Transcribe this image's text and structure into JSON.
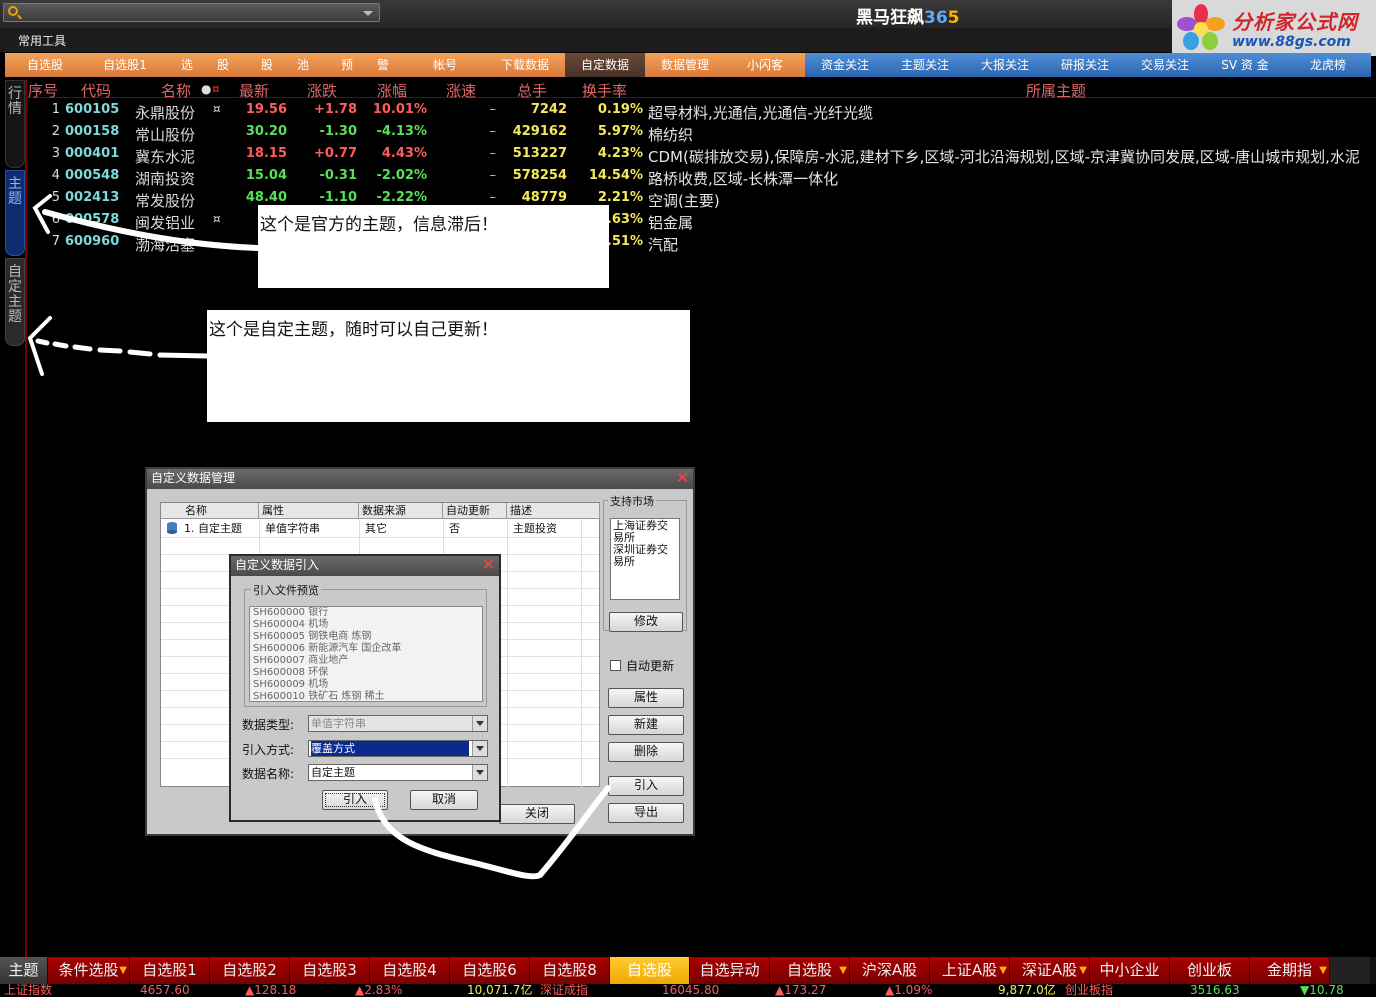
{
  "app": {
    "title_main": "黑马狂飙",
    "title_num_a": "36",
    "title_num_b": "5",
    "search_placeholder": ""
  },
  "logo": {
    "name": "分析家公式网",
    "url": "www.88gs.com"
  },
  "menu": {
    "label": "常用工具"
  },
  "top_tabs": [
    {
      "label": "自选股",
      "style": "orange"
    },
    {
      "label": "自选股1",
      "style": "orange"
    },
    {
      "label": "选　　股",
      "style": "orange"
    },
    {
      "label": "股　　池",
      "style": "orange"
    },
    {
      "label": "预　　警",
      "style": "orange"
    },
    {
      "label": "帐号",
      "style": "orange"
    },
    {
      "label": "下载数据",
      "style": "orange"
    },
    {
      "label": "自定数据",
      "style": "orange-active"
    },
    {
      "label": "数据管理",
      "style": "orange"
    },
    {
      "label": "小闪客",
      "style": "orange"
    },
    {
      "label": "资金关注",
      "style": "blue"
    },
    {
      "label": "主题关注",
      "style": "blue"
    },
    {
      "label": "大报关注",
      "style": "blue"
    },
    {
      "label": "研报关注",
      "style": "blue"
    },
    {
      "label": "交易关注",
      "style": "blue"
    },
    {
      "label": "SV 资 金",
      "style": "blue"
    },
    {
      "label": "龙虎榜",
      "style": "blue"
    }
  ],
  "side_tabs": {
    "quotes": "行情",
    "theme": "主题",
    "custom_theme": "自定主题"
  },
  "table": {
    "headers": {
      "seq": "序号",
      "code": "代码",
      "name": "名称",
      "mark": "●",
      "flag": "¤",
      "price": "最新",
      "chg": "涨跌",
      "pct": "涨幅",
      "speed": "涨速",
      "volume": "总手",
      "turnover": "换手率",
      "theme": "所属主题"
    },
    "rows": [
      {
        "seq": "1",
        "code": "600105",
        "name": "永鼎股份",
        "mark": "¤",
        "price": "19.56",
        "chg": "+1.78",
        "pct": "10.01%",
        "speed": "–",
        "volume": "7242",
        "turnover": "0.19%",
        "theme": "超导材料,光通信,光通信-光纤光缆",
        "dir": "up"
      },
      {
        "seq": "2",
        "code": "000158",
        "name": "常山股份",
        "mark": "",
        "price": "30.20",
        "chg": "-1.30",
        "pct": "-4.13%",
        "speed": "–",
        "volume": "429162",
        "turnover": "5.97%",
        "theme": "棉纺织",
        "dir": "down"
      },
      {
        "seq": "3",
        "code": "000401",
        "name": "冀东水泥",
        "mark": "",
        "price": "18.15",
        "chg": "+0.77",
        "pct": "4.43%",
        "speed": "–",
        "volume": "513227",
        "turnover": "4.23%",
        "theme": "CDM(碳排放交易),保障房-水泥,建材下乡,区域-河北沿海规划,区域-京津冀协同发展,区域-唐山城市规划,水泥",
        "dir": "up"
      },
      {
        "seq": "4",
        "code": "000548",
        "name": "湖南投资",
        "mark": "",
        "price": "15.04",
        "chg": "-0.31",
        "pct": "-2.02%",
        "speed": "–",
        "volume": "578254",
        "turnover": "14.54%",
        "theme": "路桥收费,区域-长株潭一体化",
        "dir": "down"
      },
      {
        "seq": "5",
        "code": "002413",
        "name": "常发股份",
        "mark": "",
        "price": "48.40",
        "chg": "-1.10",
        "pct": "-2.22%",
        "speed": "–",
        "volume": "48779",
        "turnover": "2.21%",
        "theme": "空调(主要)",
        "dir": "down"
      },
      {
        "seq": "6",
        "code": "000578",
        "name": "闽发铝业",
        "mark": "¤",
        "price": "4",
        "chg": "",
        "pct": "",
        "speed": "",
        "volume": "",
        "turnover": "3.63%",
        "theme": "铝金属",
        "dir": "up"
      },
      {
        "seq": "7",
        "code": "600960",
        "name": "渤海活塞",
        "mark": "",
        "price": "1",
        "chg": "",
        "pct": "",
        "speed": "",
        "volume": "",
        "turnover": "0.51%",
        "theme": "汽配",
        "dir": "up"
      }
    ]
  },
  "notes": {
    "official": "这个是官方的主题，信息滞后！",
    "custom": "这个是自定主题，随时可以自己更新！"
  },
  "dialog_manage": {
    "title": "自定义数据管理",
    "columns": [
      "名称",
      "属性",
      "数据来源",
      "自动更新",
      "描述"
    ],
    "row": {
      "name": "1. 自定主题",
      "attr": "单值字符串",
      "source": "其它",
      "auto": "否",
      "desc": "主题投资"
    },
    "market_caption": "支持市场",
    "markets": [
      "上海证券交易所",
      "深圳证券交易所"
    ],
    "btn_modify": "修改",
    "auto_update_label": "自动更新",
    "btn_attr": "属性",
    "btn_new": "新建",
    "btn_delete": "删除",
    "btn_import": "引入",
    "btn_export": "导出",
    "btn_close": "关闭"
  },
  "dialog_import": {
    "title": "自定义数据引入",
    "preview_caption": "引入文件预览",
    "preview_lines": [
      "SH600000  银行",
      "SH600004  机场",
      "SH600005  钢铁电商  炼钢",
      "SH600006  新能源汽车  国企改革",
      "SH600007  商业地产",
      "SH600008  环保",
      "SH600009  机场",
      "SH600010  铁矿石  炼钢  稀土"
    ],
    "type_label": "数据类型:",
    "type_value": "单值字符串",
    "mode_label": "引入方式:",
    "mode_value": "覆盖方式",
    "name_label": "数据名称:",
    "name_value": "自定主题",
    "btn_ok": "引入",
    "btn_cancel": "取消"
  },
  "bottom_tabs": [
    {
      "label": "主题",
      "style": "first"
    },
    {
      "label": "条件选股",
      "style": "drop"
    },
    {
      "label": "自选股1",
      "style": ""
    },
    {
      "label": "自选股2",
      "style": ""
    },
    {
      "label": "自选股3",
      "style": ""
    },
    {
      "label": "自选股4",
      "style": ""
    },
    {
      "label": "自选股6",
      "style": ""
    },
    {
      "label": "自选股8",
      "style": ""
    },
    {
      "label": "自选股",
      "style": "sel"
    },
    {
      "label": "自选异动",
      "style": ""
    },
    {
      "label": "自选股",
      "style": "drop"
    },
    {
      "label": "沪深A股",
      "style": ""
    },
    {
      "label": "上证A股",
      "style": "drop"
    },
    {
      "label": "深证A股",
      "style": "drop"
    },
    {
      "label": "中小企业",
      "style": ""
    },
    {
      "label": "创业板",
      "style": ""
    },
    {
      "label": "金期指",
      "style": "drop"
    }
  ],
  "ticker": {
    "sh_name": "上证指数",
    "sh_value": "4657.60",
    "sh_chg": "▲128.18",
    "sh_pct": "▲2.83%",
    "sh_amount": "10,071.7亿",
    "sz_name": "深证成指",
    "sz_value": "16045.80",
    "sz_chg": "▲173.27",
    "sz_pct": "▲1.09%",
    "sz_amount": "9,877.0亿",
    "cy_name": "创业板指",
    "cy_value": "3516.63",
    "cy_chg": "▼10.78"
  },
  "colors": {
    "up": "#ff5c5c",
    "down": "#58e058",
    "code": "#7fd9d9",
    "volume": "#f5e85a",
    "header": "#e06565"
  }
}
